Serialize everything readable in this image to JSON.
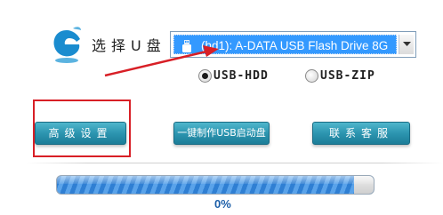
{
  "header": {
    "logo_icon": "swirl-e-logo-icon",
    "select_label": "选择U盘"
  },
  "drive_select": {
    "selected_value": "(hd1): A-DATA USB Flash Drive 8G",
    "icon": "usb-drive-icon",
    "dropdown_icon": "chevron-down-icon"
  },
  "modes": {
    "usb_hdd": {
      "label": "USB-HDD",
      "checked": true
    },
    "usb_zip": {
      "label": "USB-ZIP",
      "checked": false
    }
  },
  "buttons": {
    "advanced": "高级设置",
    "make_boot": "一键制作USB启动盘",
    "customer_service": "联系客服"
  },
  "progress": {
    "fraction": 0.0,
    "text": "0%"
  },
  "annotation": {
    "color": "#d81f26"
  }
}
